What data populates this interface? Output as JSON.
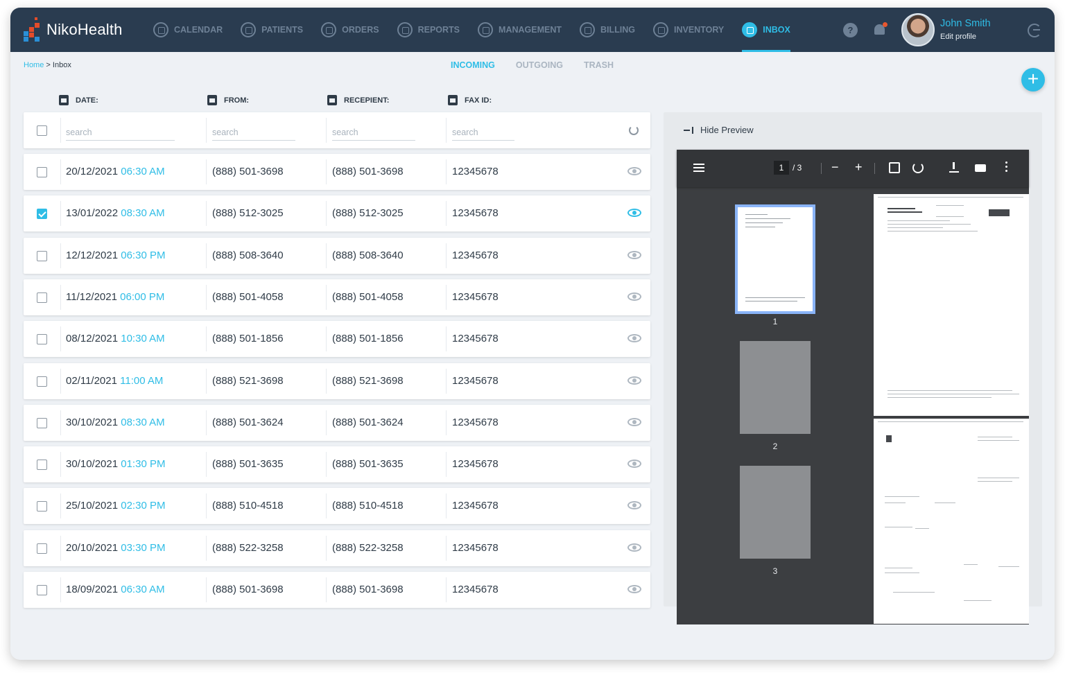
{
  "app": {
    "name": "NikoHealth"
  },
  "nav": [
    {
      "label": "CALENDAR",
      "icon": "calendar-icon",
      "active": false
    },
    {
      "label": "PATIENTS",
      "icon": "patients-icon",
      "active": false
    },
    {
      "label": "ORDERS",
      "icon": "orders-icon",
      "active": false
    },
    {
      "label": "REPORTS",
      "icon": "reports-icon",
      "active": false
    },
    {
      "label": "MANAGEMENT",
      "icon": "management-icon",
      "active": false
    },
    {
      "label": "BILLING",
      "icon": "billing-icon",
      "active": false
    },
    {
      "label": "INVENTORY",
      "icon": "inventory-icon",
      "active": false
    },
    {
      "label": "INBOX",
      "icon": "inbox-icon",
      "active": true
    }
  ],
  "user": {
    "name": "John Smith",
    "subtitle": "Edit profile"
  },
  "breadcrumb": {
    "home": "Home",
    "separator": ">",
    "current": "Inbox"
  },
  "tabs": [
    {
      "label": "INCOMING",
      "active": true
    },
    {
      "label": "OUTGOING",
      "active": false
    },
    {
      "label": "TRASH",
      "active": false
    }
  ],
  "add_button": "+",
  "columns": {
    "date": "DATE:",
    "from": "FROM:",
    "recipient": "RECEPIENT:",
    "fax_id": "FAX ID:"
  },
  "search": {
    "date": "search",
    "from": "search",
    "recipient": "search",
    "fax_id": "search"
  },
  "rows": [
    {
      "date": "20/12/2021",
      "time": "06:30 AM",
      "from": "(888) 501-3698",
      "recipient": "(888) 501-3698",
      "fax_id": "12345678",
      "checked": false,
      "viewing": false
    },
    {
      "date": "13/01/2022",
      "time": "08:30 AM",
      "from": "(888) 512-3025",
      "recipient": "(888) 512-3025",
      "fax_id": "12345678",
      "checked": true,
      "viewing": true
    },
    {
      "date": "12/12/2021",
      "time": "06:30 PM",
      "from": "(888) 508-3640",
      "recipient": "(888) 508-3640",
      "fax_id": "12345678",
      "checked": false,
      "viewing": false
    },
    {
      "date": "11/12/2021",
      "time": "06:00 PM",
      "from": "(888) 501-4058",
      "recipient": "(888) 501-4058",
      "fax_id": "12345678",
      "checked": false,
      "viewing": false
    },
    {
      "date": "08/12/2021",
      "time": "10:30 AM",
      "from": "(888) 501-1856",
      "recipient": "(888) 501-1856",
      "fax_id": "12345678",
      "checked": false,
      "viewing": false
    },
    {
      "date": "02/11/2021",
      "time": "11:00 AM",
      "from": "(888) 521-3698",
      "recipient": "(888) 521-3698",
      "fax_id": "12345678",
      "checked": false,
      "viewing": false
    },
    {
      "date": "30/10/2021",
      "time": "08:30 AM",
      "from": "(888) 501-3624",
      "recipient": "(888) 501-3624",
      "fax_id": "12345678",
      "checked": false,
      "viewing": false
    },
    {
      "date": "30/10/2021",
      "time": "01:30 PM",
      "from": "(888) 501-3635",
      "recipient": "(888) 501-3635",
      "fax_id": "12345678",
      "checked": false,
      "viewing": false
    },
    {
      "date": "25/10/2021",
      "time": "02:30 PM",
      "from": "(888) 510-4518",
      "recipient": "(888) 510-4518",
      "fax_id": "12345678",
      "checked": false,
      "viewing": false
    },
    {
      "date": "20/10/2021",
      "time": "03:30 PM",
      "from": "(888) 522-3258",
      "recipient": "(888) 522-3258",
      "fax_id": "12345678",
      "checked": false,
      "viewing": false
    },
    {
      "date": "18/09/2021",
      "time": "06:30 AM",
      "from": "(888) 501-3698",
      "recipient": "(888) 501-3698",
      "fax_id": "12345678",
      "checked": false,
      "viewing": false
    }
  ],
  "preview": {
    "toggle_label": "Hide Preview",
    "current_page": "1",
    "total_pages": "/ 3",
    "thumbnails": [
      "1",
      "2",
      "3"
    ]
  },
  "colors": {
    "accent": "#2fbde6",
    "nav_bg": "#2a3c50",
    "viewer_bg": "#3c3e41"
  }
}
